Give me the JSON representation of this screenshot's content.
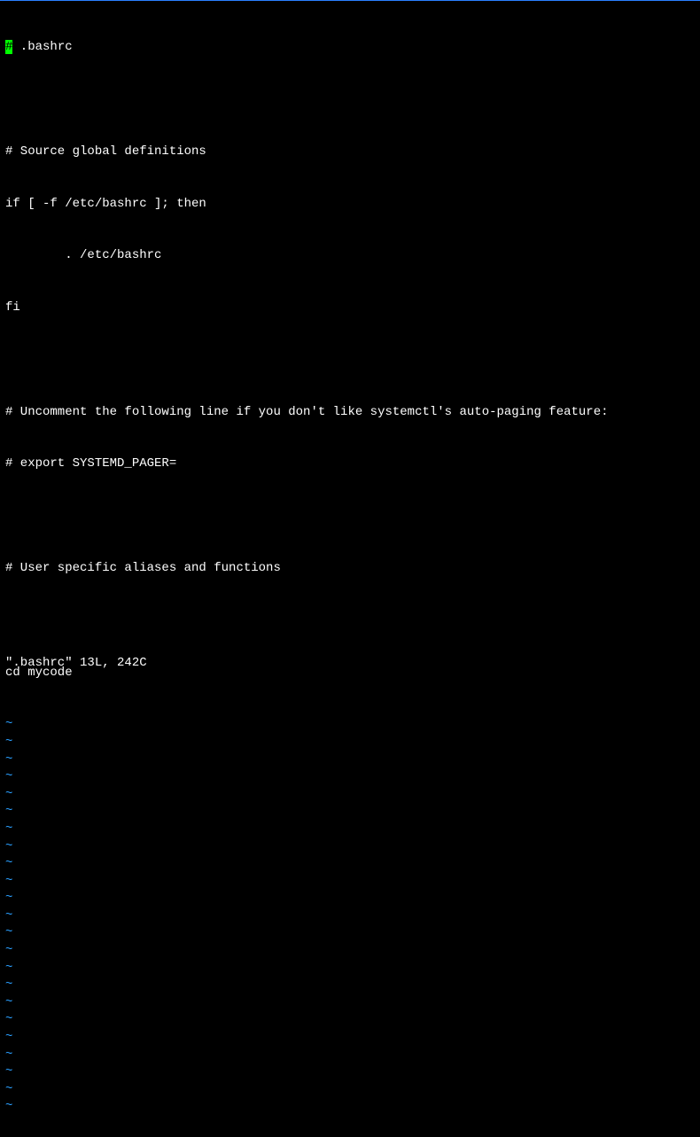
{
  "editor": {
    "cursor_char": "#",
    "lines": [
      " .bashrc",
      "",
      "# Source global definitions",
      "if [ -f /etc/bashrc ]; then",
      "        . /etc/bashrc",
      "fi",
      "",
      "# Uncomment the following line if you don't like systemctl's auto-paging feature:",
      "# export SYSTEMD_PAGER=",
      "",
      "# User specific aliases and functions",
      "",
      "cd mycode"
    ],
    "tilde": "~",
    "tilde_count": 23,
    "status": "\".bashrc\" 13L, 242C"
  }
}
